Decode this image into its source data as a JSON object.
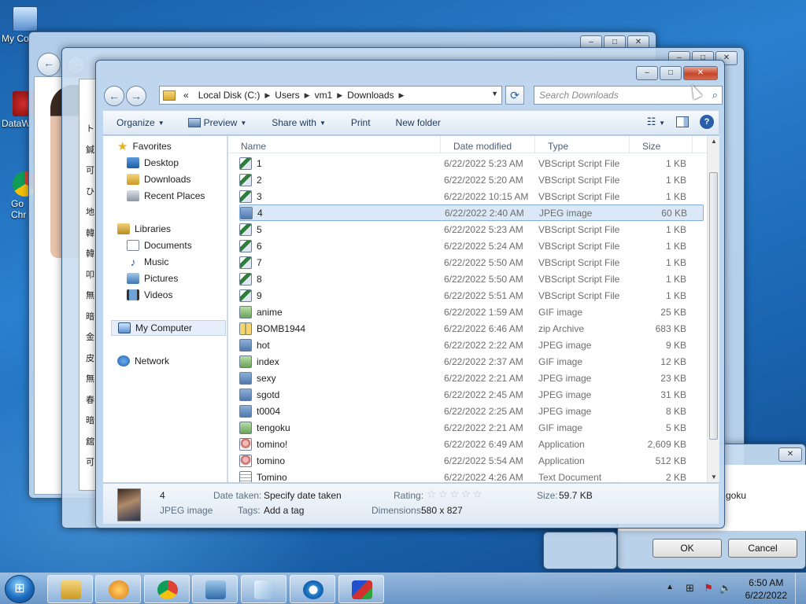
{
  "desktop": {
    "icons": [
      {
        "label": "My Co",
        "icon": "computer-icon"
      },
      {
        "label": "DataW",
        "icon": "app-icon"
      },
      {
        "label": "Go\nChr",
        "icon": "chrome-icon"
      }
    ]
  },
  "explorer": {
    "address": {
      "overflow": "«",
      "crumbs": [
        "Local Disk (C:)",
        "Users",
        "vm1",
        "Downloads"
      ]
    },
    "search_placeholder": "Search Downloads",
    "toolbar": {
      "organize": "Organize",
      "preview": "Preview",
      "share_with": "Share with",
      "print": "Print",
      "new_folder": "New folder"
    },
    "nav": {
      "favorites": "Favorites",
      "desktop": "Desktop",
      "downloads": "Downloads",
      "recent_places": "Recent Places",
      "libraries": "Libraries",
      "documents": "Documents",
      "music": "Music",
      "pictures": "Pictures",
      "videos": "Videos",
      "my_computer": "My Computer",
      "network": "Network"
    },
    "columns": {
      "name": "Name",
      "date_modified": "Date modified",
      "type": "Type",
      "size": "Size"
    },
    "files": [
      {
        "name": "1",
        "date": "6/22/2022 5:23 AM",
        "type": "VBScript Script File",
        "size": "1 KB",
        "icon": "vbs"
      },
      {
        "name": "2",
        "date": "6/22/2022 5:20 AM",
        "type": "VBScript Script File",
        "size": "1 KB",
        "icon": "vbs"
      },
      {
        "name": "3",
        "date": "6/22/2022 10:15 AM",
        "type": "VBScript Script File",
        "size": "1 KB",
        "icon": "vbs"
      },
      {
        "name": "4",
        "date": "6/22/2022 2:40 AM",
        "type": "JPEG image",
        "size": "60 KB",
        "icon": "jpeg",
        "selected": true
      },
      {
        "name": "5",
        "date": "6/22/2022 5:23 AM",
        "type": "VBScript Script File",
        "size": "1 KB",
        "icon": "vbs"
      },
      {
        "name": "6",
        "date": "6/22/2022 5:24 AM",
        "type": "VBScript Script File",
        "size": "1 KB",
        "icon": "vbs"
      },
      {
        "name": "7",
        "date": "6/22/2022 5:50 AM",
        "type": "VBScript Script File",
        "size": "1 KB",
        "icon": "vbs"
      },
      {
        "name": "8",
        "date": "6/22/2022 5:50 AM",
        "type": "VBScript Script File",
        "size": "1 KB",
        "icon": "vbs"
      },
      {
        "name": "9",
        "date": "6/22/2022 5:51 AM",
        "type": "VBScript Script File",
        "size": "1 KB",
        "icon": "vbs"
      },
      {
        "name": "anime",
        "date": "6/22/2022 1:59 AM",
        "type": "GIF image",
        "size": "25 KB",
        "icon": "gif"
      },
      {
        "name": "BOMB1944",
        "date": "6/22/2022 6:46 AM",
        "type": "zip Archive",
        "size": "683 KB",
        "icon": "zip"
      },
      {
        "name": "hot",
        "date": "6/22/2022 2:22 AM",
        "type": "JPEG image",
        "size": "9 KB",
        "icon": "jpeg"
      },
      {
        "name": "index",
        "date": "6/22/2022 2:37 AM",
        "type": "GIF image",
        "size": "12 KB",
        "icon": "gif"
      },
      {
        "name": "sexy",
        "date": "6/22/2022 2:21 AM",
        "type": "JPEG image",
        "size": "23 KB",
        "icon": "jpeg"
      },
      {
        "name": "sgotd",
        "date": "6/22/2022 2:45 AM",
        "type": "JPEG image",
        "size": "31 KB",
        "icon": "jpeg"
      },
      {
        "name": "t0004",
        "date": "6/22/2022 2:25 AM",
        "type": "JPEG image",
        "size": "8 KB",
        "icon": "jpeg"
      },
      {
        "name": "tengoku",
        "date": "6/22/2022 2:21 AM",
        "type": "GIF image",
        "size": "5 KB",
        "icon": "gif"
      },
      {
        "name": "tomino!",
        "date": "6/22/2022 6:49 AM",
        "type": "Application",
        "size": "2,609 KB",
        "icon": "app"
      },
      {
        "name": "tomino",
        "date": "6/22/2022 5:54 AM",
        "type": "Application",
        "size": "512 KB",
        "icon": "app"
      },
      {
        "name": "Tomino",
        "date": "6/22/2022 4:26 AM",
        "type": "Text Document",
        "size": "2 KB",
        "icon": "txt"
      }
    ],
    "details": {
      "name": "4",
      "type": "JPEG image",
      "date_taken_label": "Date taken:",
      "date_taken_value": "Specify date taken",
      "tags_label": "Tags:",
      "tags_value": "Add a tag",
      "rating_label": "Rating:",
      "rating_stars": "☆☆☆☆☆",
      "dimensions_label": "Dimensions:",
      "dimensions_value": "580 x 827",
      "size_label": "Size:",
      "size_value": "59.7 KB"
    }
  },
  "dialog": {
    "partial_text": "goku",
    "ok": "OK",
    "cancel": "Cancel"
  },
  "taskbar": {
    "time": "6:50 AM",
    "date": "6/22/2022"
  },
  "background_window": {
    "side_chars": [
      "ト",
      "鍼",
      "可",
      "ひ",
      "地",
      "韓",
      "韓",
      "叩",
      "無",
      "暗",
      "金",
      "皮",
      "無",
      "春",
      "暗",
      "舘",
      "可"
    ]
  }
}
